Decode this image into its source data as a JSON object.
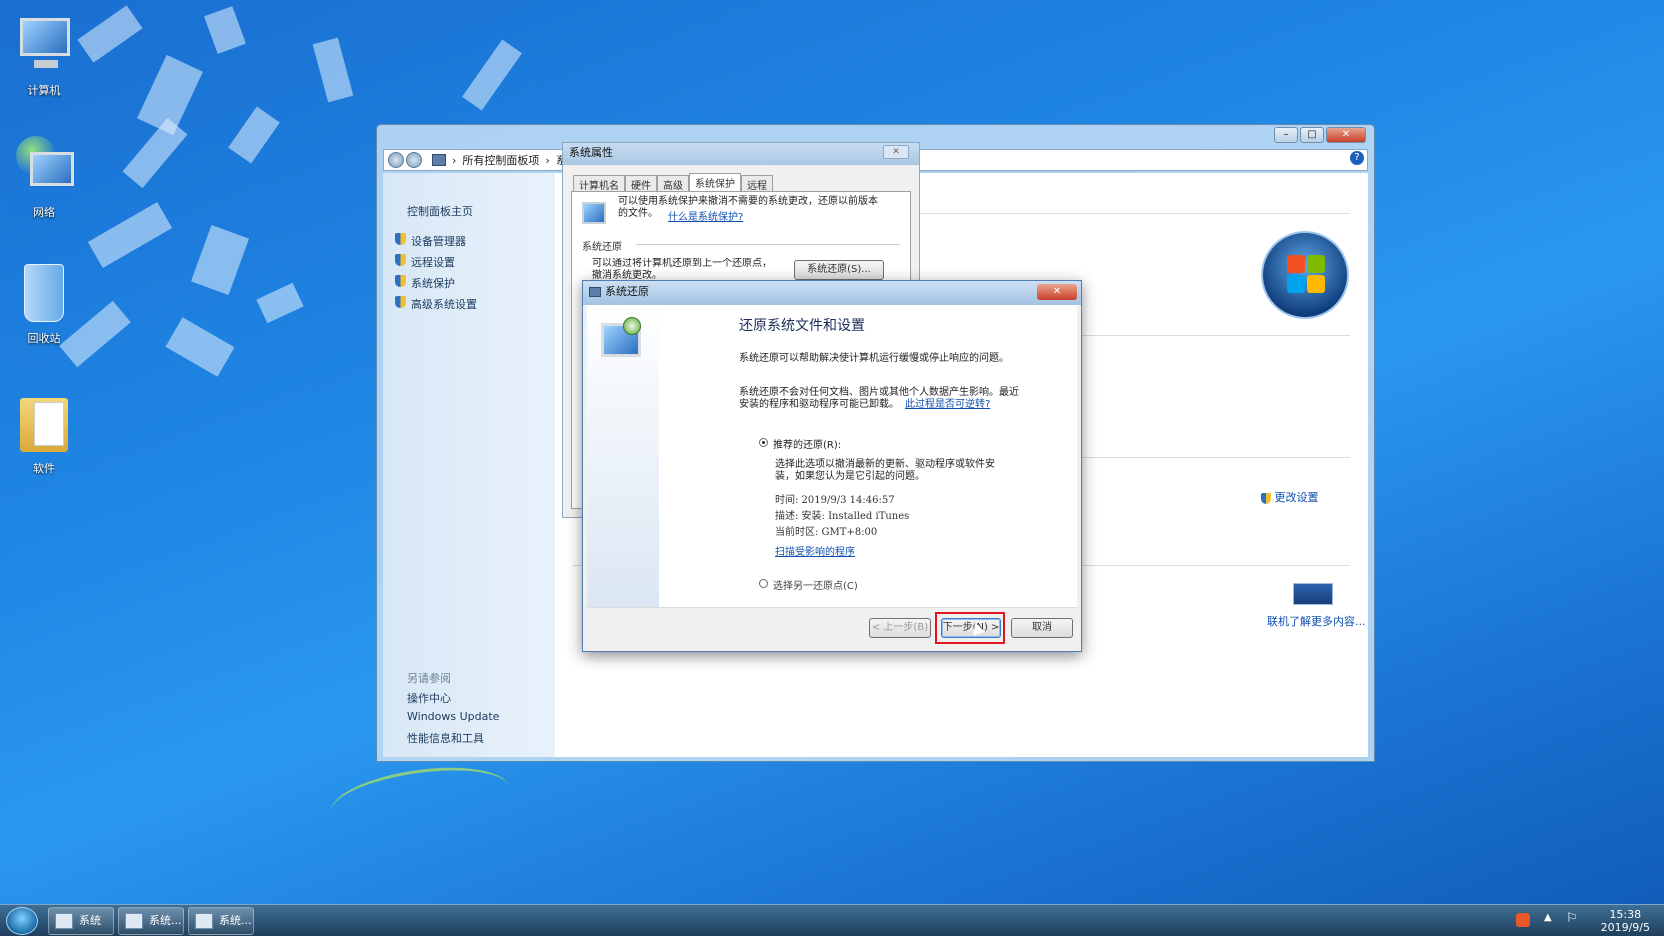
{
  "desktop": {
    "icons": [
      {
        "label": "计算机"
      },
      {
        "label": "网络"
      },
      {
        "label": "回收站"
      },
      {
        "label": "软件"
      }
    ]
  },
  "taskbar": {
    "buttons": [
      "系统",
      "系统...",
      "系统..."
    ],
    "time": "15:38",
    "date": "2019/9/5"
  },
  "system_window": {
    "breadcrumb": [
      "所有控制面板项",
      "系统"
    ],
    "sidebar": {
      "home": "控制面板主页",
      "links": [
        "设备管理器",
        "远程设置",
        "系统保护",
        "高级系统设置"
      ],
      "see_also_title": "另请参阅",
      "see_also": [
        "操作中心",
        "Windows Update",
        "性能信息和工具"
      ]
    },
    "change_settings": "更改设置",
    "learn_more": "联机了解更多内容..."
  },
  "system_properties": {
    "title": "系统属性",
    "tabs": [
      "计算机名",
      "硬件",
      "高级",
      "系统保护",
      "远程"
    ],
    "active_tab": "系统保护",
    "desc": "可以使用系统保护来撤消不需要的系统更改，还原以前版本的文件。",
    "desc_link": "什么是系统保护?",
    "section_title": "系统还原",
    "section_text": "可以通过将计算机还原到上一个还原点，撤消系统更改。",
    "restore_button": "系统还原(S)..."
  },
  "restore_dialog": {
    "title": "系统还原",
    "heading": "还原系统文件和设置",
    "para1": "系统还原可以帮助解决使计算机运行缓慢或停止响应的问题。",
    "para2_line1": "系统还原不会对任何文档、图片或其他个人数据产生影响。最近",
    "para2_line2": "安装的程序和驱动程序可能已卸载。",
    "para2_link": "此过程是否可逆转?",
    "option1": "推荐的还原(R):",
    "option1_desc_line1": "选择此选项以撤消最新的更新、驱动程序或软件安",
    "option1_desc_line2": "装，如果您认为是它引起的问题。",
    "time": "时间: 2019/9/3 14:46:57",
    "description": "描述: 安装: Installed iTunes",
    "timezone": "当前时区: GMT+8:00",
    "scan_link": "扫描受影响的程序",
    "option2": "选择另一还原点(C)",
    "back_button": "< 上一步(B)",
    "next_button": "下一步(N) >",
    "cancel_button": "取消",
    "selected_option": "option1"
  },
  "colors": {
    "highlight_box": "#e0141e",
    "link": "#0f4fb0"
  }
}
